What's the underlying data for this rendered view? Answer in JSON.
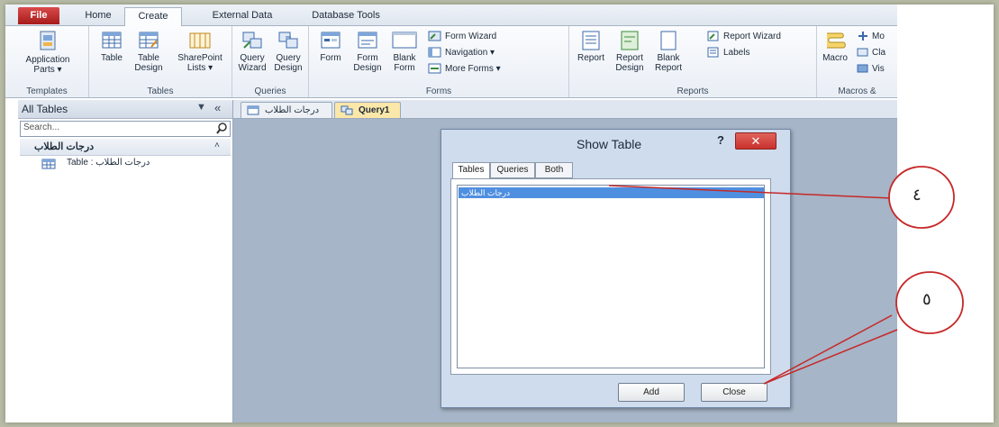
{
  "tabs": [
    "File",
    "Home",
    "Create",
    "External Data",
    "Database Tools"
  ],
  "ribbon": {
    "templates": {
      "label": "Templates",
      "app_parts": "Application",
      "app_parts2": "Parts ▾"
    },
    "tables": {
      "label": "Tables",
      "table": "Table",
      "table_design": "Table",
      "table_design2": "Design",
      "sharepoint": "SharePoint",
      "sharepoint2": "Lists ▾"
    },
    "queries": {
      "label": "Queries",
      "wizard": "Query",
      "wizard2": "Wizard",
      "design": "Query",
      "design2": "Design"
    },
    "forms": {
      "label": "Forms",
      "form": "Form",
      "form_design": "Form",
      "form_design2": "Design",
      "blank_form": "Blank",
      "blank_form2": "Form",
      "form_wizard": "Form Wizard",
      "navigation": "Navigation ▾",
      "more_forms": "More Forms ▾"
    },
    "reports": {
      "label": "Reports",
      "report": "Report",
      "report_design": "Report",
      "report_design2": "Design",
      "blank_report": "Blank",
      "blank_report2": "Report",
      "report_wizard": "Report Wizard",
      "labels": "Labels"
    },
    "macros": {
      "label": "Macros &",
      "macro": "Macro",
      "mo": "Mo",
      "cla": "Cla",
      "vis": "Vis"
    }
  },
  "nav": {
    "title": "All Tables",
    "search_placeholder": "Search...",
    "group": "درجات الطلاب",
    "item": "درجات الطلاب : Table"
  },
  "doc_tabs": [
    "درجات الطلاب",
    "Query1"
  ],
  "dialog": {
    "title": "Show Table",
    "help": "?",
    "tabs": [
      "Tables",
      "Queries",
      "Both"
    ],
    "list_items": [
      "درجات الطلاب"
    ],
    "add_label": "Add",
    "close_label": "Close"
  },
  "annotations": [
    "٤",
    "٥"
  ],
  "colors": {
    "file_tab": "#c62828",
    "selection": "#4f8fe0",
    "close_btn": "#c9302c",
    "annotation": "#c62828"
  }
}
